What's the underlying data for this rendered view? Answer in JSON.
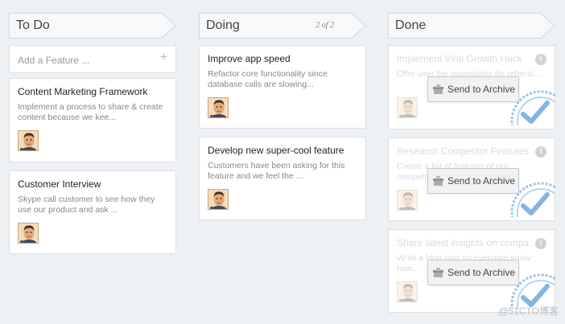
{
  "columns": {
    "todo": {
      "title": "To Do",
      "add_placeholder": "Add a Feature ...",
      "add_icon": "+",
      "cards": [
        {
          "title": "Content Marketing Framework",
          "desc": "Implement a process to share & create content because we kee..."
        },
        {
          "title": "Customer Interview",
          "desc": "Skype call customer to see how they use our product and ask ..."
        }
      ]
    },
    "doing": {
      "title": "Doing",
      "count": "2 of 2",
      "cards": [
        {
          "title": "Improve app speed",
          "desc": "Refactor core functionality since database calls are slowing..."
        },
        {
          "title": "Develop new super-cool feature",
          "desc": "Customers have been asking for this feature and we feel the ..."
        }
      ]
    },
    "done": {
      "title": "Done",
      "archive_label": "Send to Archive",
      "info_icon": "i",
      "cards": [
        {
          "title": "Implement Viral Growth Hack",
          "desc": "Offer user the opportunity for referral..."
        },
        {
          "title": "Research Competitor Features",
          "desc": "Create a list of features of our competitors..."
        },
        {
          "title": "Share latest insights on compa...",
          "desc": "Write a blog post so everyone know how..."
        }
      ]
    }
  },
  "watermark": "@51CTO博客",
  "colors": {
    "background": "#eef1f4",
    "card": "#ffffff",
    "border": "#dcdfe3",
    "stamp_blue": "#9ec3e6"
  }
}
